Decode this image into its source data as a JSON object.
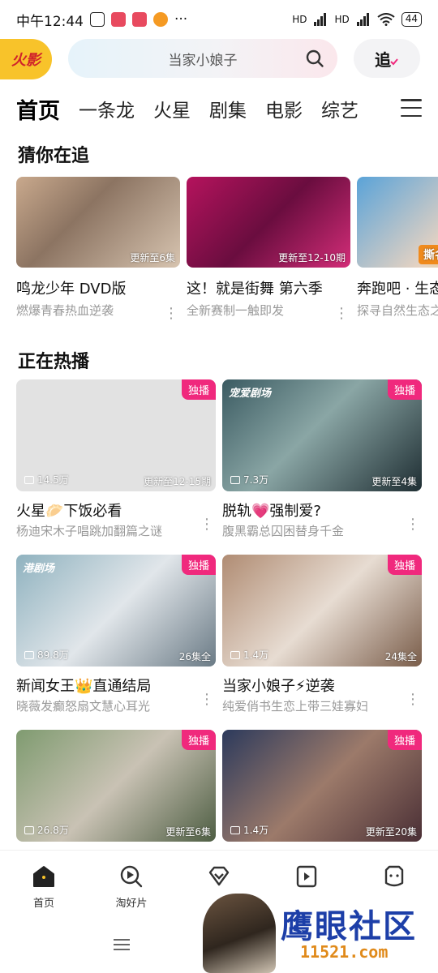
{
  "status_bar": {
    "time": "中午12:44",
    "dots": "···",
    "network_1": "HD",
    "network_2": "HD",
    "battery": "44"
  },
  "header": {
    "logo_text": "火影",
    "search_placeholder": "当家小娘子",
    "follow_label": "追"
  },
  "tabs": [
    "首页",
    "一条龙",
    "火星",
    "剧集",
    "电影",
    "综艺"
  ],
  "chase": {
    "title": "猜你在追",
    "items": [
      {
        "title": "鸣龙少年 DVD版",
        "subtitle": "燃爆青春热血逆袭",
        "episode": "更新至6集"
      },
      {
        "title": "这！就是街舞 第六季",
        "subtitle": "全新赛制一触即发",
        "episode": "更新至12-10期"
      },
      {
        "title": "奔跑吧 · 生态",
        "subtitle": "探寻自然生态之",
        "episode": "撕名牌"
      }
    ]
  },
  "hot": {
    "title": "正在热播",
    "items": [
      {
        "title": "火星🥟下饭必看",
        "subtitle": "杨迪宋木子唱跳加翻篇之谜",
        "views": "14.5万",
        "episode": "更新至12-15期",
        "badge": "独播"
      },
      {
        "title": "脱轨💗强制爱?",
        "subtitle": "腹黑霸总囚困替身千金",
        "views": "7.3万",
        "episode": "更新至4集",
        "badge": "独播",
        "poster_logo": "宠爱剧场"
      },
      {
        "title": "新闻女王👑直通结局",
        "subtitle": "晓薇发癫怒扇文慧心耳光",
        "views": "89.8万",
        "episode": "26集全",
        "badge": "独播",
        "poster_logo": "港剧场"
      },
      {
        "title": "当家小娘子⚡逆袭",
        "subtitle": "纯爱俏书生恋上带三娃寡妇",
        "views": "1.4万",
        "episode": "24集全",
        "badge": "独播"
      },
      {
        "title": "",
        "subtitle": "",
        "views": "26.8万",
        "episode": "更新至6集",
        "badge": "独播"
      },
      {
        "title": "",
        "subtitle": "",
        "views": "1.4万",
        "episode": "更新至20集",
        "badge": "独播"
      }
    ]
  },
  "bottom_nav": [
    {
      "label": "首页",
      "icon": "home-icon"
    },
    {
      "label": "淘好片",
      "icon": "discover-icon"
    },
    {
      "label": "",
      "icon": "vip-diamond-icon"
    },
    {
      "label": "",
      "icon": "short-video-icon"
    },
    {
      "label": "",
      "icon": "profile-icon"
    }
  ],
  "watermark": {
    "text": "鹰眼社区",
    "url": "11521.com"
  }
}
